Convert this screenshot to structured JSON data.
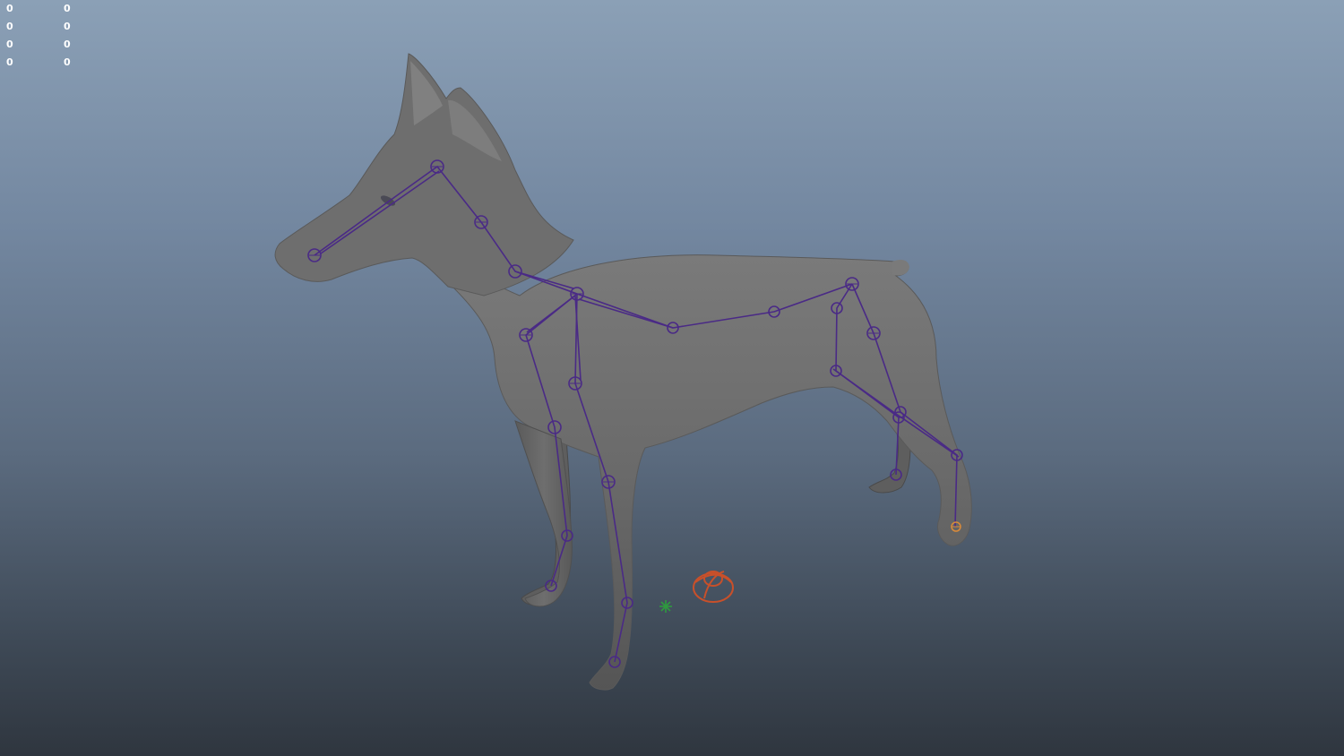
{
  "viewport": {
    "hud_stats": [
      {
        "col_a": "0",
        "col_b": "0"
      },
      {
        "col_a": "0",
        "col_b": "0"
      },
      {
        "col_a": "0",
        "col_b": "0"
      },
      {
        "col_a": "0",
        "col_b": "0"
      }
    ]
  },
  "colors": {
    "background_top": "#8ba0b6",
    "background_bottom": "#2f363f",
    "model_surface": "#6c6c6c",
    "skeleton": "#4a2a86",
    "controller": "#c8502a",
    "locator": "#2e9a3e",
    "hud_text": "#ffffff"
  },
  "icons": [
    "pivot-locator-icon",
    "controller-handle-icon"
  ]
}
